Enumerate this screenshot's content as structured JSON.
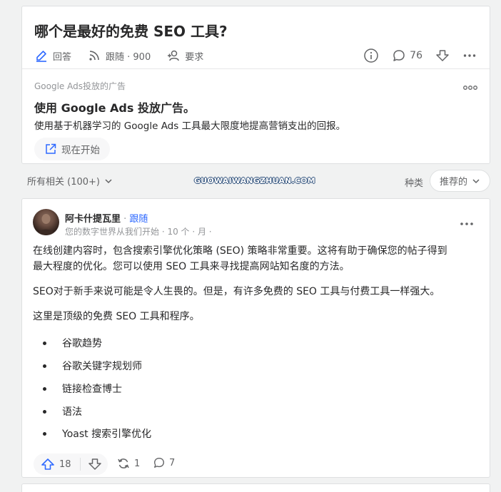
{
  "question": {
    "title": "哪个是最好的免费 SEO 工具?",
    "answer_label": "回答",
    "follow_label": "跟随 · 900",
    "request_label": "要求",
    "comment_count": "76"
  },
  "ad": {
    "tag": "Google Ads投放的广告",
    "title": "使用 Google Ads 投放广告。",
    "description": "使用基于机器学习的 Google Ads 工具最大限度地提高营销支出的回报。",
    "cta": "现在开始"
  },
  "filter": {
    "all_related": "所有相关 (100+)",
    "watermark": "GUOWAIWANGZHUAN.COM",
    "sort_label": "种类",
    "sort_value": "推荐的"
  },
  "answer": {
    "author": "阿卡什提瓦里",
    "separator": " · ",
    "follow": "跟随",
    "subtitle": "您的数字世界从我们开始 · 10 个 · 月 ·",
    "paragraphs": [
      "在线创建内容时，包含搜索引擎优化策略 (SEO) 策略非常重要。这将有助于确保您的帖子得到",
      "最大程度的优化。您可以使用 SEO 工具来寻找提高网站知名度的方法。",
      "SEO对于新手来说可能是令人生畏的。但是，有许多免费的 SEO 工具与付费工具一样强大。",
      "这里是顶级的免费 SEO 工具和程序。"
    ],
    "bullets": [
      "谷歌趋势",
      "谷歌关键字规划师",
      "链接检查博士",
      "语法",
      "Yoast 搜索引擎优化"
    ],
    "upvotes": "18",
    "shares": "1",
    "comments": "7"
  },
  "colors": {
    "accent": "#2e69ff",
    "text": "#282829",
    "muted": "#636466"
  }
}
